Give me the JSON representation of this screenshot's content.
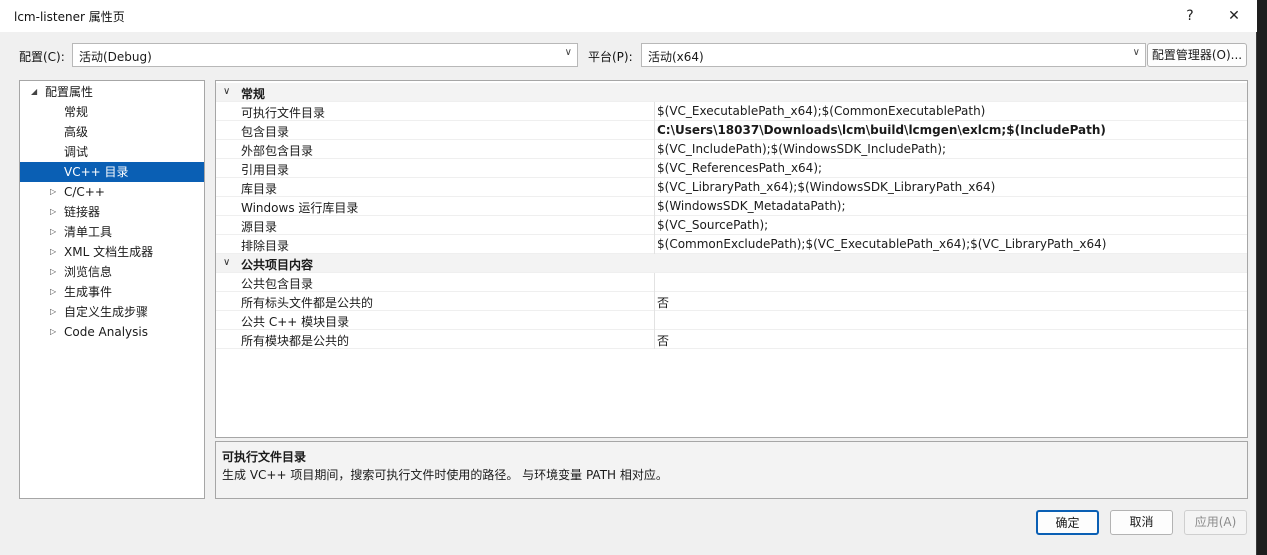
{
  "window": {
    "title": "lcm-listener 属性页",
    "help": "?",
    "close": "✕"
  },
  "config": {
    "label": "配置(C):",
    "value": "活动(Debug)",
    "platform_label": "平台(P):",
    "platform_value": "活动(x64)",
    "manager_button": "配置管理器(O)..."
  },
  "tree": {
    "items": [
      {
        "label": "配置属性",
        "arrow": "◢",
        "indent": 0
      },
      {
        "label": "常规",
        "arrow": "",
        "indent": 1
      },
      {
        "label": "高级",
        "arrow": "",
        "indent": 1
      },
      {
        "label": "调试",
        "arrow": "",
        "indent": 1
      },
      {
        "label": "VC++ 目录",
        "arrow": "",
        "indent": 1,
        "selected": true
      },
      {
        "label": "C/C++",
        "arrow": "▷",
        "indent": 1
      },
      {
        "label": "链接器",
        "arrow": "▷",
        "indent": 1
      },
      {
        "label": "清单工具",
        "arrow": "▷",
        "indent": 1
      },
      {
        "label": "XML 文档生成器",
        "arrow": "▷",
        "indent": 1
      },
      {
        "label": "浏览信息",
        "arrow": "▷",
        "indent": 1
      },
      {
        "label": "生成事件",
        "arrow": "▷",
        "indent": 1
      },
      {
        "label": "自定义生成步骤",
        "arrow": "▷",
        "indent": 1
      },
      {
        "label": "Code Analysis",
        "arrow": "▷",
        "indent": 1
      }
    ]
  },
  "grid": {
    "categories": [
      {
        "name": "常规",
        "rows": [
          {
            "name": "可执行文件目录",
            "value": "$(VC_ExecutablePath_x64);$(CommonExecutablePath)",
            "bold": false
          },
          {
            "name": "包含目录",
            "value": "C:\\Users\\18037\\Downloads\\lcm\\build\\lcmgen\\exlcm;$(IncludePath)",
            "bold": true
          },
          {
            "name": "外部包含目录",
            "value": "$(VC_IncludePath);$(WindowsSDK_IncludePath);",
            "bold": false
          },
          {
            "name": "引用目录",
            "value": "$(VC_ReferencesPath_x64);",
            "bold": false
          },
          {
            "name": "库目录",
            "value": "$(VC_LibraryPath_x64);$(WindowsSDK_LibraryPath_x64)",
            "bold": false
          },
          {
            "name": "Windows 运行库目录",
            "value": "$(WindowsSDK_MetadataPath);",
            "bold": false
          },
          {
            "name": "源目录",
            "value": "$(VC_SourcePath);",
            "bold": false
          },
          {
            "name": "排除目录",
            "value": "$(CommonExcludePath);$(VC_ExecutablePath_x64);$(VC_LibraryPath_x64)",
            "bold": false
          }
        ]
      },
      {
        "name": "公共项目内容",
        "rows": [
          {
            "name": "公共包含目录",
            "value": "",
            "bold": false
          },
          {
            "name": "所有标头文件都是公共的",
            "value": "否",
            "bold": false
          },
          {
            "name": "公共 C++ 模块目录",
            "value": "",
            "bold": false
          },
          {
            "name": "所有模块都是公共的",
            "value": "否",
            "bold": false
          }
        ]
      }
    ]
  },
  "description": {
    "title": "可执行文件目录",
    "text": "生成 VC++ 项目期间，搜索可执行文件时使用的路径。 与环境变量 PATH 相对应。"
  },
  "buttons": {
    "ok": "确定",
    "cancel": "取消",
    "apply": "应用(A)"
  },
  "colors": {
    "selection": "#0a5fb4",
    "accent_border": "#0a5fb4"
  }
}
